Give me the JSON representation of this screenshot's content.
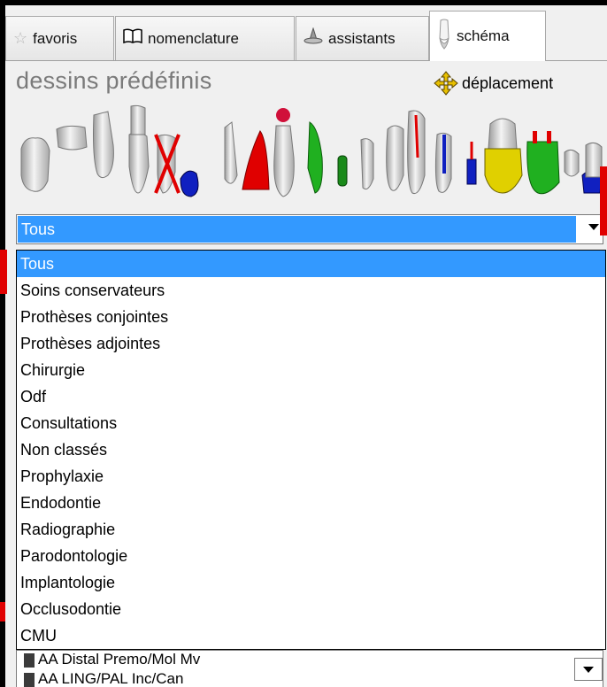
{
  "tabs": [
    {
      "label": "favoris",
      "icon": "star-icon"
    },
    {
      "label": "nomenclature",
      "icon": "book-icon"
    },
    {
      "label": "assistants",
      "icon": "wizard-hat-icon"
    },
    {
      "label": "schéma",
      "icon": "tooth-icon",
      "active": true
    }
  ],
  "header": {
    "title": "dessins prédéfinis",
    "move_label": "déplacement"
  },
  "filter": {
    "selected": "Tous",
    "options": [
      "Tous",
      "Soins conservateurs",
      "Prothèses conjointes",
      "Prothèses adjointes",
      "Chirurgie",
      "Odf",
      "Consultations",
      "Non classés",
      "Prophylaxie",
      "Endodontie",
      "Radiographie",
      "Parodontologie",
      "Implantologie",
      "Occlusodontie",
      "CMU"
    ]
  },
  "items": [
    {
      "label": "AA Distal Premo/Mol Mv"
    },
    {
      "label": "AA LING/PAL Inc/Can"
    }
  ],
  "colors": {
    "selection": "#3399ff",
    "marker": "#e00000",
    "tooth": "#dcdcdc",
    "red": "#e00000",
    "blue": "#1020c0",
    "green": "#20b020",
    "yellow": "#e0d000"
  }
}
